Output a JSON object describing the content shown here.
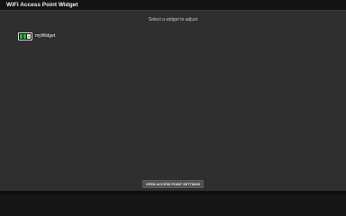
{
  "window": {
    "title": "WiFi Access Point Widget"
  },
  "main": {
    "hint": "Select a widget to adjust",
    "widgets": [
      {
        "label": "myWidget",
        "icon": "wifi-widget-icon"
      }
    ]
  },
  "footer": {
    "open_settings_label": "OPEN ACCESS POINT SETTINGS"
  },
  "colors": {
    "background": "#2f2f2f",
    "titlebar": "#131313",
    "widget_icon_green": "#1fbf2a"
  }
}
